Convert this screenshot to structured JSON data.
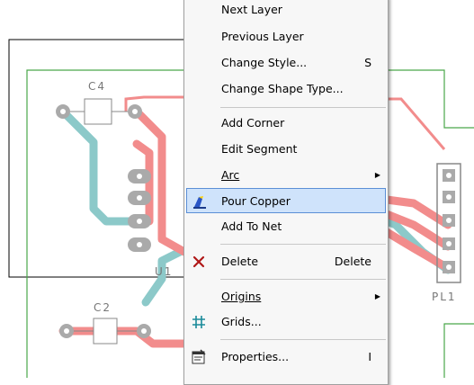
{
  "pcb": {
    "labels": {
      "c4": "C4",
      "c2": "C2",
      "u1": "U1",
      "pl1": "PL1"
    }
  },
  "menu": {
    "items": [
      {
        "label": "Next Layer",
        "shortcut": ""
      },
      {
        "label": "Previous Layer",
        "shortcut": ""
      },
      {
        "label": "Change Style...",
        "shortcut": "S"
      },
      {
        "label": "Change Shape Type...",
        "shortcut": ""
      },
      {
        "label": "Add Corner",
        "shortcut": ""
      },
      {
        "label": "Edit Segment",
        "shortcut": ""
      },
      {
        "label": "Arc",
        "shortcut": "",
        "submenu": true
      },
      {
        "label": "Pour Copper",
        "shortcut": "",
        "icon": "pour-copper-icon",
        "selected": true
      },
      {
        "label": "Add To Net",
        "shortcut": ""
      },
      {
        "label": "Delete",
        "shortcut": "Delete",
        "icon": "delete-x-icon"
      },
      {
        "label": "Origins",
        "shortcut": "",
        "submenu": true
      },
      {
        "label": "Grids...",
        "shortcut": "",
        "icon": "grid-icon"
      },
      {
        "label": "Properties...",
        "shortcut": "I",
        "icon": "properties-icon"
      }
    ]
  },
  "colors": {
    "trace_top": "#f28c8c",
    "trace_bottom": "#8cc9c9",
    "board_outline": "#4aa84a",
    "selection_bg": "#cfe3fb",
    "selection_border": "#5b8fd6"
  }
}
